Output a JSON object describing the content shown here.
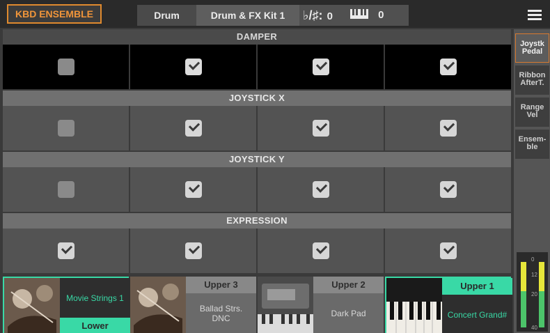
{
  "top_bar": {
    "brand_label": "KBD ENSEMBLE",
    "tab_drum": "Drum",
    "tab_kit": "Drum & FX Kit 1",
    "transpose_symbol": "♭/♯:",
    "transpose_value": "0",
    "octave_value": "0",
    "menu_icon": "hamburger-menu-icon",
    "keyboard_icon": "keyboard-icon"
  },
  "sections": [
    {
      "label": "DAMPER",
      "active": true,
      "checks": [
        false,
        true,
        true,
        true
      ]
    },
    {
      "label": "JOYSTICK X",
      "active": false,
      "checks": [
        false,
        true,
        true,
        true
      ]
    },
    {
      "label": "JOYSTICK Y",
      "active": false,
      "checks": [
        false,
        true,
        true,
        true
      ]
    },
    {
      "label": "EXPRESSION",
      "active": false,
      "checks": [
        true,
        true,
        true,
        true
      ]
    }
  ],
  "side_tabs": [
    {
      "label": "Joystk\nPedal",
      "active": true
    },
    {
      "label": "Ribbon\nAfterT.",
      "active": false
    },
    {
      "label": "Range\nVel",
      "active": false
    },
    {
      "label": "Ensem-\nble",
      "active": false
    }
  ],
  "meter": {
    "labels": [
      "0",
      "12",
      "20",
      "40"
    ],
    "colors": {
      "low": "#4cc46a",
      "high": "#e6e63a"
    }
  },
  "tracks": [
    {
      "name": "Lower",
      "sound": "Movie Strings 1",
      "selected": true,
      "lower": true,
      "thumb": "violin-image"
    },
    {
      "name": "Upper 3",
      "sound": "Ballad Strs. DNC",
      "selected": false,
      "lower": false,
      "thumb": "violin-image"
    },
    {
      "name": "Upper 2",
      "sound": "Dark Pad",
      "selected": false,
      "lower": false,
      "thumb": "synth-keyboard-image"
    },
    {
      "name": "Upper 1",
      "sound": "Concert Grand#",
      "selected": true,
      "lower": false,
      "thumb": "piano-keys-image"
    }
  ],
  "colors": {
    "accent_orange": "#e08a2e",
    "accent_green": "#39d9a6"
  }
}
